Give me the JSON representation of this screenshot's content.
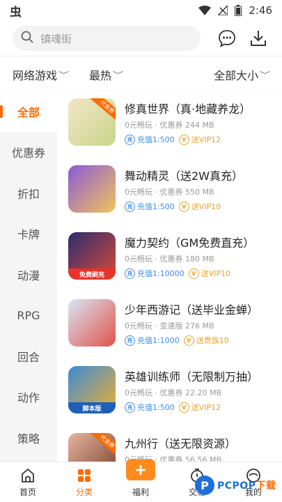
{
  "status_bar": {
    "app_glyph": "虫",
    "time": "2:46"
  },
  "search": {
    "placeholder": "镇魂街"
  },
  "filters": {
    "category": "网络游戏",
    "sort": "最热",
    "size": "全部大小"
  },
  "sidebar": {
    "items": [
      {
        "label": "全部",
        "active": true
      },
      {
        "label": "优惠券"
      },
      {
        "label": "折扣"
      },
      {
        "label": "卡牌"
      },
      {
        "label": "动漫"
      },
      {
        "label": "RPG"
      },
      {
        "label": "回合"
      },
      {
        "label": "动作"
      },
      {
        "label": "策略"
      }
    ]
  },
  "games": [
    {
      "name": "修真世界（真·地藏养龙）",
      "meta": "0元畅玩 · 优惠券  244 MB",
      "tag1": "充值1:500",
      "tag2": "送VIP12",
      "tag2_color": "gold",
      "thumb_colors": [
        "#f3e6c7",
        "#c8d48a"
      ],
      "corner": "代金券"
    },
    {
      "name": "舞动精灵（送2W真充）",
      "meta": "0元畅玩 · 优惠券  550 MB",
      "tag1": "充值1:500",
      "tag2": "送VIP10",
      "tag2_color": "gold",
      "thumb_colors": [
        "#8a5ad6",
        "#f2c35c"
      ],
      "corner": ""
    },
    {
      "name": "魔力契约（GM免费直充）",
      "meta": "0元畅玩 · 优惠券  180 MB",
      "tag1": "充值1:10000",
      "tag2": "送VIP10",
      "tag2_color": "gold",
      "thumb_colors": [
        "#2b2d6e",
        "#d94a3a"
      ],
      "corner": "",
      "band": "免费刷充"
    },
    {
      "name": "少年西游记（送毕业金蝉）",
      "meta": "0元畅玩 · 变速版  276 MB",
      "tag1": "充值1:1000",
      "tag2": "送贵族10",
      "tag2_color": "gold",
      "thumb_colors": [
        "#d8e6f5",
        "#e0524a"
      ],
      "corner": ""
    },
    {
      "name": "英雄训练师（无限制万抽）",
      "meta": "0元畅玩 · 优惠券  22.20 MB",
      "tag1": "充值1:500",
      "tag2": "送VIP12",
      "tag2_color": "gold",
      "thumb_colors": [
        "#3a8bd6",
        "#f0b030"
      ],
      "corner": "",
      "band": "脚本版"
    },
    {
      "name": "九州行（送无限资源）",
      "meta": "0元畅玩 · 优惠券  56.56 MB",
      "tag1": "",
      "tag2": "",
      "tag2_color": "gold",
      "thumb_colors": [
        "#e6b6a0",
        "#7a3f2a"
      ],
      "corner": "代金券"
    }
  ],
  "bottom_nav": {
    "items": [
      {
        "label": "首页",
        "icon": "home-icon"
      },
      {
        "label": "分类",
        "icon": "grid-icon",
        "active": true
      },
      {
        "label": "福利",
        "icon": "gift-icon"
      },
      {
        "label": "交易",
        "icon": "trade-icon"
      },
      {
        "label": "我的",
        "icon": "profile-icon"
      }
    ]
  },
  "watermark": {
    "brand": "PCPOP",
    "suffix": "下载"
  },
  "colors": {
    "accent": "#ff6a00",
    "blue_tag": "#3b8cf0",
    "gold_tag": "#f0a020"
  }
}
